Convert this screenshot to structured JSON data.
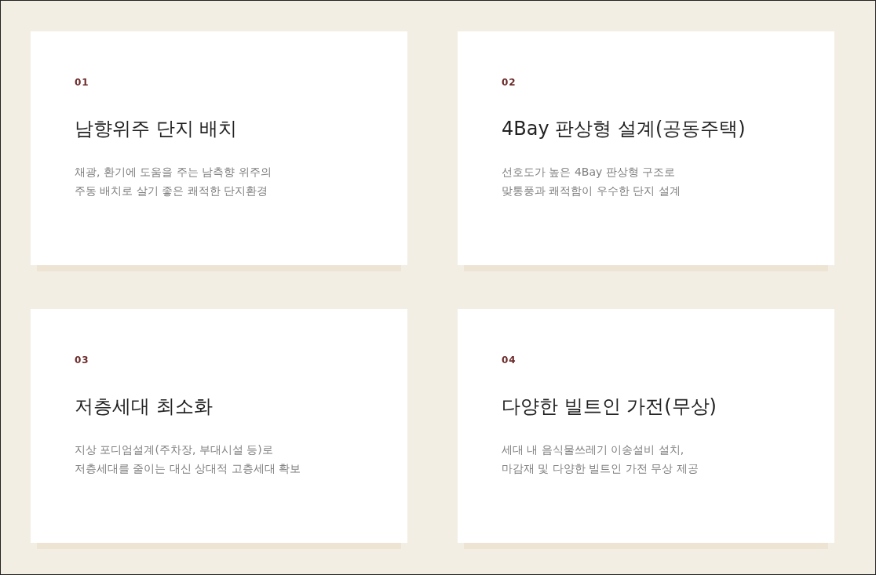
{
  "features": [
    {
      "number": "01",
      "title": "남향위주 단지 배치",
      "description": "채광, 환기에 도움을 주는 남측향 위주의\n주동 배치로 살기 좋은 쾌적한 단지환경"
    },
    {
      "number": "02",
      "title": "4Bay 판상형 설계(공동주택)",
      "description": "선호도가 높은 4Bay 판상형 구조로\n맞통풍과 쾌적함이 우수한 단지 설계"
    },
    {
      "number": "03",
      "title": "저층세대 최소화",
      "description": "지상 포디엄설계(주차장, 부대시설 등)로\n저층세대를 줄이는 대신 상대적 고층세대 확보"
    },
    {
      "number": "04",
      "title": "다양한 빌트인 가전(무상)",
      "description": "세대 내 음식물쓰레기 이송설비 설치,\n마감재 및 다양한 빌트인 가전 무상 제공"
    }
  ]
}
